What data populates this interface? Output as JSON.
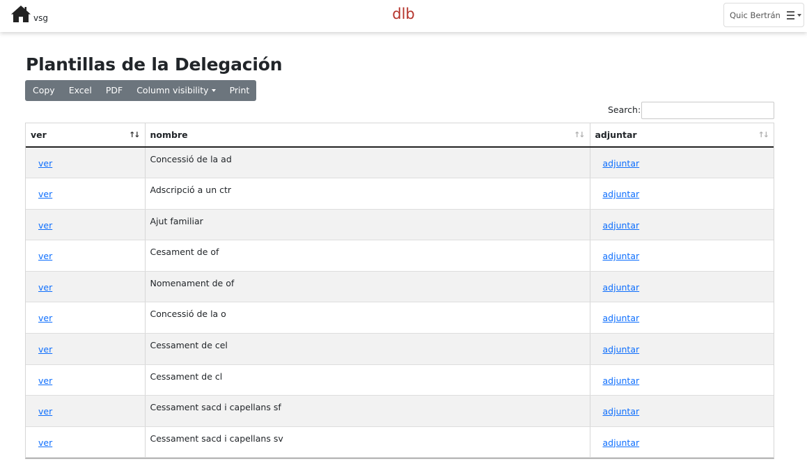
{
  "nav": {
    "home_label": "vsg",
    "brand": "dlb",
    "user_name": "Quic Bertrán"
  },
  "page": {
    "title": "Plantillas de la Delegación"
  },
  "buttons": {
    "copy": "Copy",
    "excel": "Excel",
    "pdf": "PDF",
    "column_visibility": "Column visibility",
    "print": "Print"
  },
  "search": {
    "label": "Search:",
    "value": ""
  },
  "table": {
    "headers": [
      "ver",
      "nombre",
      "adjuntar"
    ],
    "rows": [
      {
        "ver": "ver",
        "nombre": "Concessió de la ad",
        "adjuntar": "adjuntar"
      },
      {
        "ver": "ver",
        "nombre": "Adscripció a un ctr",
        "adjuntar": "adjuntar"
      },
      {
        "ver": "ver",
        "nombre": "Ajut familiar",
        "adjuntar": "adjuntar"
      },
      {
        "ver": "ver",
        "nombre": "Cesament de of",
        "adjuntar": "adjuntar"
      },
      {
        "ver": "ver",
        "nombre": "Nomenament de of",
        "adjuntar": "adjuntar"
      },
      {
        "ver": "ver",
        "nombre": "Concessió de la o",
        "adjuntar": "adjuntar"
      },
      {
        "ver": "ver",
        "nombre": "Cessament de cel",
        "adjuntar": "adjuntar"
      },
      {
        "ver": "ver",
        "nombre": "Cessament de cl",
        "adjuntar": "adjuntar"
      },
      {
        "ver": "ver",
        "nombre": "Cessament sacd i capellans sf",
        "adjuntar": "adjuntar"
      },
      {
        "ver": "ver",
        "nombre": "Cessament sacd i capellans sv",
        "adjuntar": "adjuntar"
      }
    ]
  },
  "colors": {
    "brand": "#b5342c",
    "button_group": "#6c757d",
    "link": "#0d6efd",
    "row_stripe": "#f2f2f2"
  },
  "icons": {
    "home": "home-icon",
    "menu": "hamburger-menu-icon",
    "sort": "sort-arrows-icon"
  }
}
